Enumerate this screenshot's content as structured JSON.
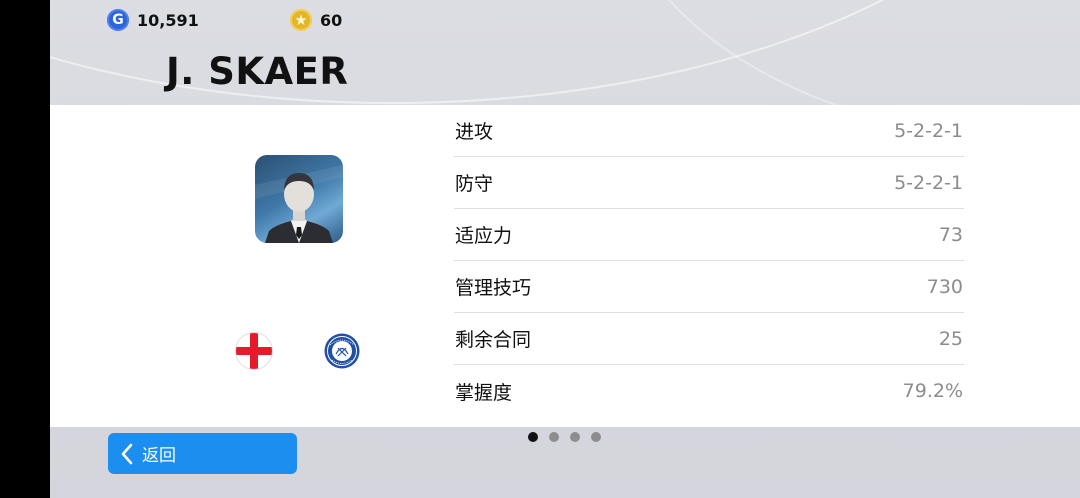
{
  "currency": {
    "gp": {
      "icon": "gp-coin-icon",
      "letter": "G",
      "amount": "10,591",
      "color": "#2f63d8"
    },
    "coins": {
      "icon": "star-coin-icon",
      "symbol": "★",
      "amount": "60",
      "color": "#e2b52a"
    }
  },
  "manager": {
    "name": "J. SKAER",
    "portrait_icon": "manager-silhouette-icon",
    "nationality_icon": "england-flag-icon",
    "club_icon": "club-crest-icon"
  },
  "stats": [
    {
      "label": "进攻",
      "value": "5-2-2-1"
    },
    {
      "label": "防守",
      "value": "5-2-2-1"
    },
    {
      "label": "适应力",
      "value": "73"
    },
    {
      "label": "管理技巧",
      "value": "730"
    },
    {
      "label": "剩余合同",
      "value": "25"
    },
    {
      "label": "掌握度",
      "value": "79.2%"
    }
  ],
  "pagination": {
    "total": 4,
    "active": 1
  },
  "back_button": {
    "label": "返回",
    "icon": "chevron-left-icon",
    "color": "#1c8ef0"
  }
}
